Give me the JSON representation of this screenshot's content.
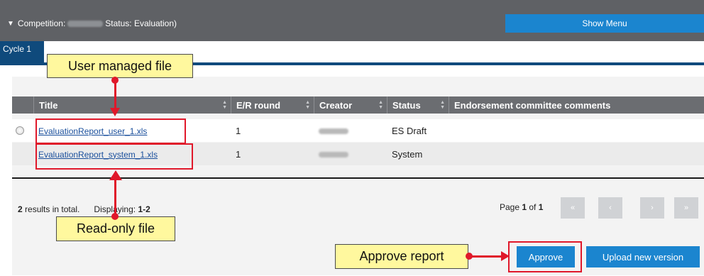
{
  "header": {
    "competition_prefix": "Competition:",
    "status_text": "Status: Evaluation)",
    "show_menu_label": "Show Menu"
  },
  "cycle_tab": {
    "label": "Cycle 1"
  },
  "table": {
    "columns": [
      "Title",
      "E/R round",
      "Creator",
      "Status",
      "Endorsement committee comments"
    ],
    "rows": [
      {
        "title": "EvaluationReport_user_1.xls",
        "round": "1",
        "status": "ES Draft",
        "comments": ""
      },
      {
        "title": "EvaluationReport_system_1.xls",
        "round": "1",
        "status": "System",
        "comments": ""
      }
    ]
  },
  "pagination": {
    "results_count": "2",
    "results_suffix": " results in total.",
    "displaying_label": "Displaying: ",
    "displaying_range": "1-2",
    "page_prefix": "Page ",
    "page_current": "1",
    "page_of": " of ",
    "page_total": "1",
    "first_label": "«",
    "prev_label": "‹",
    "next_label": "›",
    "last_label": "»"
  },
  "actions": {
    "approve_label": "Approve",
    "upload_label": "Upload new version"
  },
  "annotations": {
    "user_managed": "User managed file",
    "read_only": "Read-only file",
    "approve_report": "Approve report"
  },
  "colors": {
    "header_bg": "#5f6165",
    "accent_blue": "#1b85cf",
    "navy": "#0f4a7c",
    "annotation_red": "#e0182a",
    "callout_yellow": "#fff89e"
  }
}
